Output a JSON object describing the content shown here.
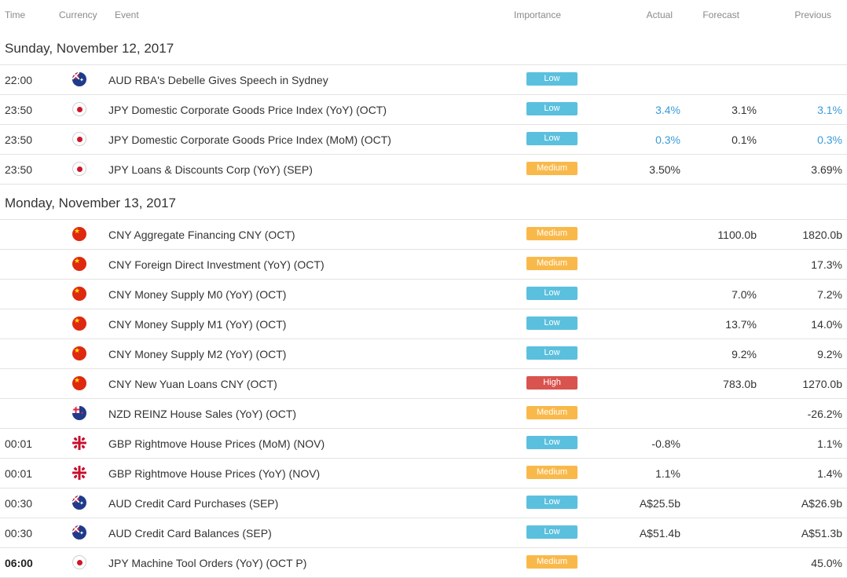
{
  "columns": {
    "time": "Time",
    "currency": "Currency",
    "event": "Event",
    "importance": "Importance",
    "actual": "Actual",
    "forecast": "Forecast",
    "previous": "Previous"
  },
  "colors": {
    "low": "#5bc0de",
    "medium": "#f9b94a",
    "high": "#d9534f",
    "highlight_value": "#3a9ad9"
  },
  "days": [
    {
      "label": "Sunday, November 12, 2017",
      "events": [
        {
          "time": "22:00",
          "flag": "aud-flag-icon",
          "event": "AUD RBA's Debelle Gives Speech in Sydney",
          "importance": "Low",
          "actual": "",
          "forecast": "",
          "previous": "",
          "highlight": false
        },
        {
          "time": "23:50",
          "flag": "jpy-flag-icon",
          "event": "JPY Domestic Corporate Goods Price Index (YoY) (OCT)",
          "importance": "Low",
          "actual": "3.4%",
          "forecast": "3.1%",
          "previous": "3.1%",
          "highlight": true
        },
        {
          "time": "23:50",
          "flag": "jpy-flag-icon",
          "event": "JPY Domestic Corporate Goods Price Index (MoM) (OCT)",
          "importance": "Low",
          "actual": "0.3%",
          "forecast": "0.1%",
          "previous": "0.3%",
          "highlight": true
        },
        {
          "time": "23:50",
          "flag": "jpy-flag-icon",
          "event": "JPY Loans & Discounts Corp (YoY) (SEP)",
          "importance": "Medium",
          "actual": "3.50%",
          "forecast": "",
          "previous": "3.69%",
          "highlight": false
        }
      ]
    },
    {
      "label": "Monday, November 13, 2017",
      "events": [
        {
          "time": "",
          "flag": "cny-flag-icon",
          "event": "CNY Aggregate Financing CNY (OCT)",
          "importance": "Medium",
          "actual": "",
          "forecast": "1100.0b",
          "previous": "1820.0b",
          "highlight": false
        },
        {
          "time": "",
          "flag": "cny-flag-icon",
          "event": "CNY Foreign Direct Investment (YoY) (OCT)",
          "importance": "Medium",
          "actual": "",
          "forecast": "",
          "previous": "17.3%",
          "highlight": false
        },
        {
          "time": "",
          "flag": "cny-flag-icon",
          "event": "CNY Money Supply M0 (YoY) (OCT)",
          "importance": "Low",
          "actual": "",
          "forecast": "7.0%",
          "previous": "7.2%",
          "highlight": false
        },
        {
          "time": "",
          "flag": "cny-flag-icon",
          "event": "CNY Money Supply M1 (YoY) (OCT)",
          "importance": "Low",
          "actual": "",
          "forecast": "13.7%",
          "previous": "14.0%",
          "highlight": false
        },
        {
          "time": "",
          "flag": "cny-flag-icon",
          "event": "CNY Money Supply M2 (YoY) (OCT)",
          "importance": "Low",
          "actual": "",
          "forecast": "9.2%",
          "previous": "9.2%",
          "highlight": false
        },
        {
          "time": "",
          "flag": "cny-flag-icon",
          "event": "CNY New Yuan Loans CNY (OCT)",
          "importance": "High",
          "actual": "",
          "forecast": "783.0b",
          "previous": "1270.0b",
          "highlight": false
        },
        {
          "time": "",
          "flag": "nzd-flag-icon",
          "event": "NZD REINZ House Sales (YoY) (OCT)",
          "importance": "Medium",
          "actual": "",
          "forecast": "",
          "previous": "-26.2%",
          "highlight": false
        },
        {
          "time": "00:01",
          "flag": "gbp-flag-icon",
          "event": "GBP Rightmove House Prices (MoM) (NOV)",
          "importance": "Low",
          "actual": "-0.8%",
          "forecast": "",
          "previous": "1.1%",
          "highlight": false
        },
        {
          "time": "00:01",
          "flag": "gbp-flag-icon",
          "event": "GBP Rightmove House Prices (YoY) (NOV)",
          "importance": "Medium",
          "actual": "1.1%",
          "forecast": "",
          "previous": "1.4%",
          "highlight": false
        },
        {
          "time": "00:30",
          "flag": "aud-flag-icon",
          "event": "AUD Credit Card Purchases (SEP)",
          "importance": "Low",
          "actual": "A$25.5b",
          "forecast": "",
          "previous": "A$26.9b",
          "highlight": false
        },
        {
          "time": "00:30",
          "flag": "aud-flag-icon",
          "event": "AUD Credit Card Balances (SEP)",
          "importance": "Low",
          "actual": "A$51.4b",
          "forecast": "",
          "previous": "A$51.3b",
          "highlight": false
        },
        {
          "time": "06:00",
          "flag": "jpy-flag-icon",
          "event": "JPY Machine Tool Orders (YoY) (OCT P)",
          "importance": "Medium",
          "actual": "",
          "forecast": "",
          "previous": "45.0%",
          "highlight": false,
          "bold_time": true
        }
      ]
    }
  ]
}
